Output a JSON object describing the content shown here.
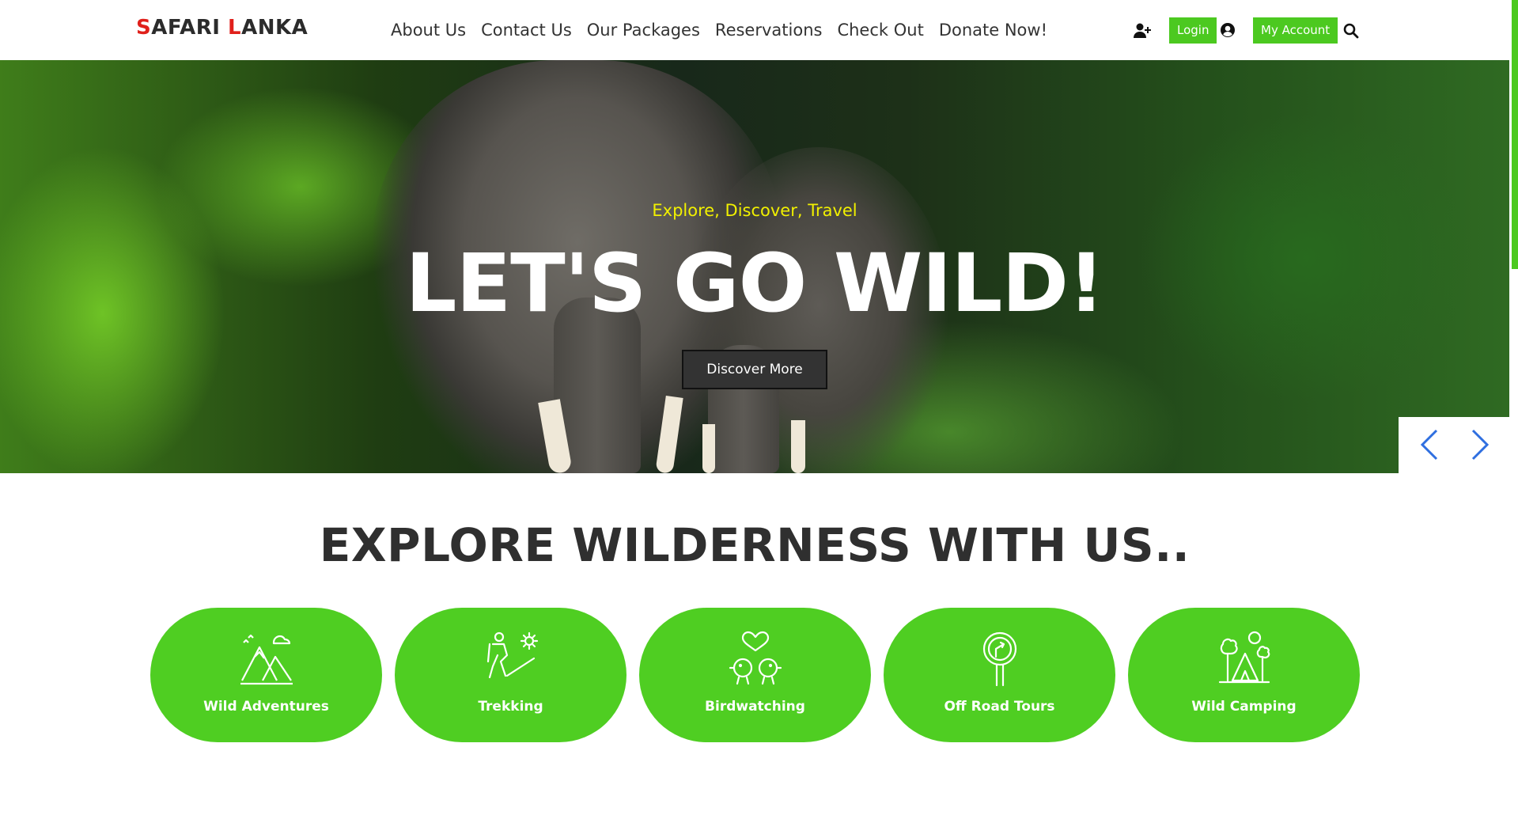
{
  "brand": {
    "first_initial": "S",
    "first_rest": "AFARI ",
    "second_initial": "L",
    "second_rest": "ANKA"
  },
  "nav": [
    {
      "label": "About Us"
    },
    {
      "label": "Contact Us"
    },
    {
      "label": "Our Packages"
    },
    {
      "label": "Reservations"
    },
    {
      "label": "Check Out"
    },
    {
      "label": "Donate Now!"
    }
  ],
  "header": {
    "login_label": "Login",
    "account_label": "My Account",
    "icons": [
      "add-user-icon",
      "user-circle-icon",
      "search-icon"
    ]
  },
  "hero": {
    "subtitle": "Explore, Discover, Travel",
    "title": "LET'S GO WILD!",
    "button_label": "Discover More"
  },
  "explore": {
    "title": "EXPLORE WILDERNESS WITH US..",
    "items": [
      {
        "label": "Wild Adventures",
        "icon": "mountains-icon"
      },
      {
        "label": "Trekking",
        "icon": "hiker-icon"
      },
      {
        "label": "Birdwatching",
        "icon": "birds-icon"
      },
      {
        "label": "Off Road Tours",
        "icon": "signpost-icon"
      },
      {
        "label": "Wild Camping",
        "icon": "tent-icon"
      }
    ]
  },
  "colors": {
    "accent": "#4cc920",
    "brand_red": "#e0201b",
    "hero_subtitle": "#f1f000",
    "arrow_blue": "#2f6fe0"
  }
}
